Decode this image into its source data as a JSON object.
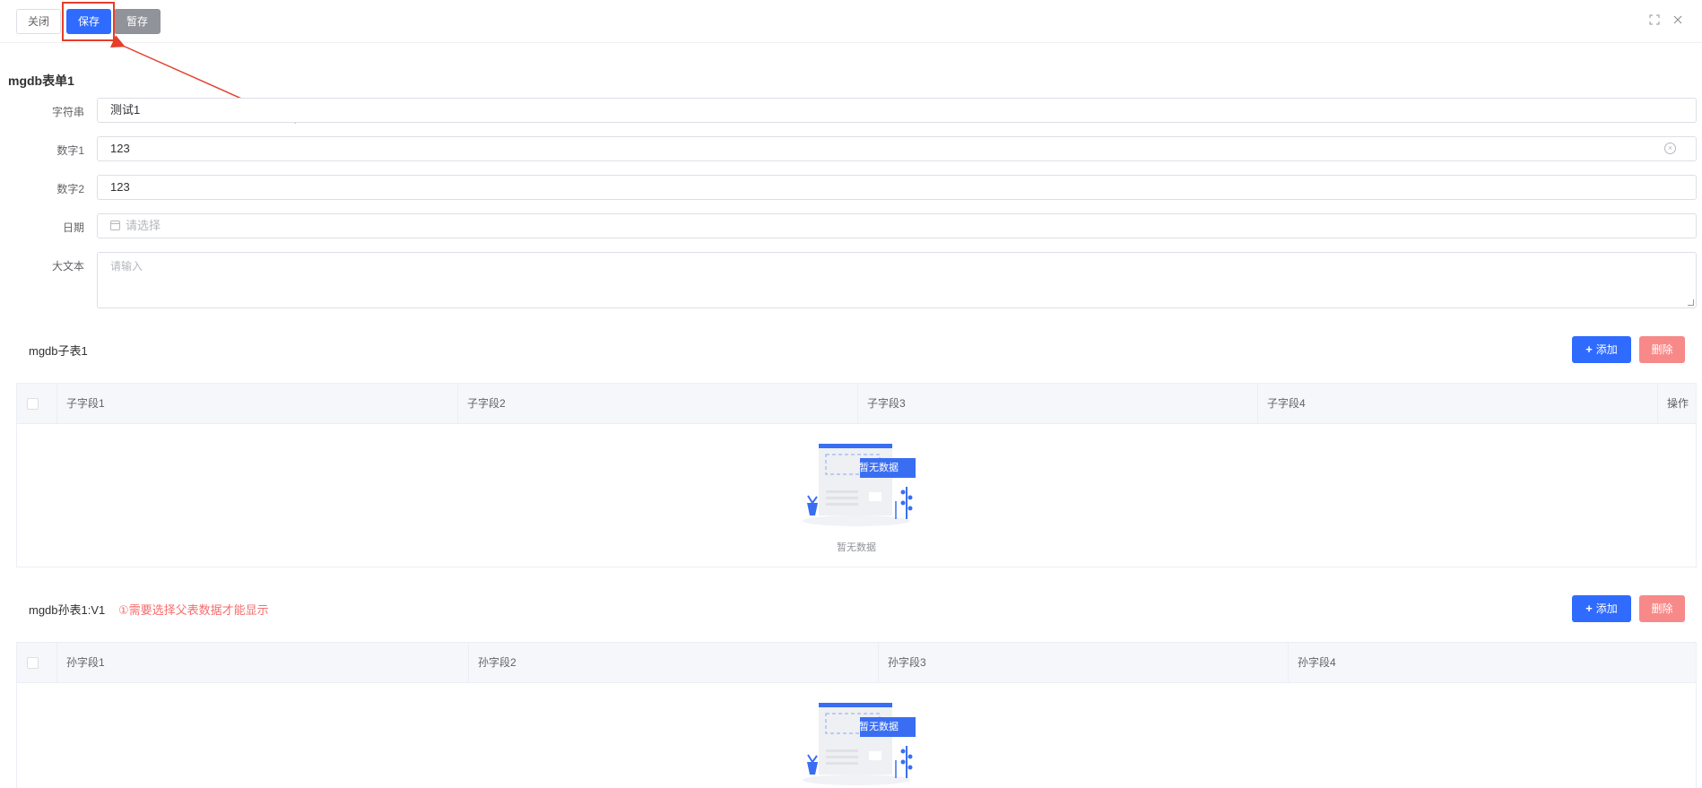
{
  "toolbar": {
    "close_label": "关闭",
    "save_label": "保存",
    "draft_label": "暂存",
    "fullscreen_icon": "expand-icon",
    "close_icon": "close-icon"
  },
  "form": {
    "title": "mgdb表单1",
    "fields": [
      {
        "label": "字符串",
        "value": "测试1",
        "placeholder": ""
      },
      {
        "label": "数字1",
        "value": "123",
        "placeholder": ""
      },
      {
        "label": "数字2",
        "value": "123",
        "placeholder": ""
      },
      {
        "label": "日期",
        "value": "",
        "placeholder": "请选择"
      },
      {
        "label": "大文本",
        "value": "",
        "placeholder": "请输入"
      }
    ]
  },
  "subtable1": {
    "title": "mgdb子表1",
    "add_label": "添加",
    "delete_label": "删除",
    "columns": [
      "子字段1",
      "子字段2",
      "子字段3",
      "子字段4",
      "操作"
    ],
    "empty_badge": "暂无数据",
    "empty_text": "暂无数据"
  },
  "subtable2": {
    "title": "mgdb孙表1:V1",
    "warning": "①需要选择父表数据才能显示",
    "add_label": "添加",
    "delete_label": "删除",
    "columns": [
      "孙字段1",
      "孙字段2",
      "孙字段3",
      "孙字段4"
    ],
    "empty_badge": "暂无数据"
  },
  "colors": {
    "primary": "#2f6bff",
    "danger": "#f78989",
    "warning_text": "#f56c6c",
    "highlight": "#e53e2a"
  }
}
